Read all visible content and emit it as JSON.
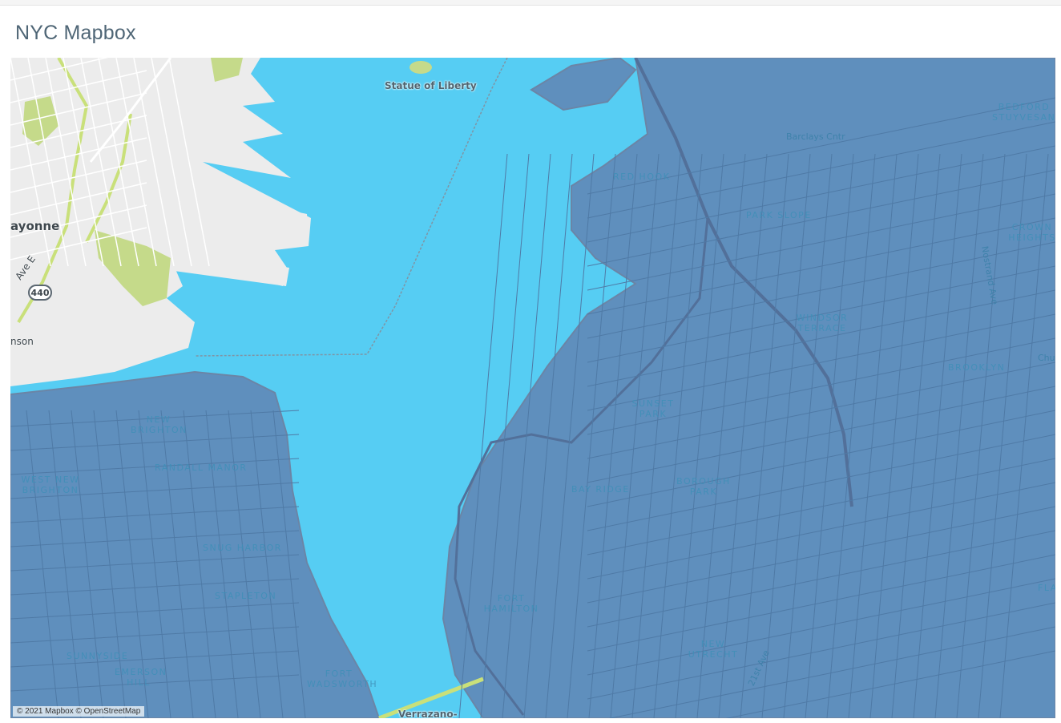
{
  "dashboard": {
    "title": "NYC Mapbox"
  },
  "map": {
    "attribution": "© 2021 Mapbox © OpenStreetMap",
    "colors": {
      "water": "#56cdf3",
      "land": "#ececec",
      "park": "#c5da8a",
      "overlay": "#5f8fbd",
      "overlay_edge": "#6b85a6",
      "road": "#ffffff",
      "highway": "#c9e07a"
    },
    "labels": {
      "statue": "Statue of Liberty",
      "bayonne": "ayonne",
      "ave_e": "Ave E",
      "route": "440",
      "robinson": "nson",
      "verrazzano": "Verrazano-",
      "new_brighton": "NEW BRIGHTON",
      "west_new_brighton": "WEST NEW BRIGHTON",
      "randall_manor": "RANDALL MANOR",
      "snug_harbor": "SNUG HARBOR",
      "stapleton": "STAPLETON",
      "sunnyside": "SUNNYSIDE",
      "emerson_hill": "EMERSON HILL",
      "fort_wadsworth": "FORT WADSWORTH",
      "red_hook": "RED HOOK",
      "park_slope": "PARK SLOPE",
      "windsor_terrace": "WINDSOR TERRACE",
      "sunset_park": "SUNSET PARK",
      "bay_ridge": "BAY RIDGE",
      "borough_park": "BOROUGH PARK",
      "fort_hamilton": "FORT HAMILTON",
      "new_utrecht": "NEW UTRECHT",
      "crown_heights": "CROWN HEIGHTS",
      "bedford_stuyvesant": "BEDFORD STUYVESANT",
      "brooklyn": "BROOKLYN",
      "flatbush": "FLA",
      "barclays": "Barclays Cntr",
      "nostrand": "Nostrand Ave",
      "ave_21": "21st Ave",
      "church": "Chu"
    }
  }
}
